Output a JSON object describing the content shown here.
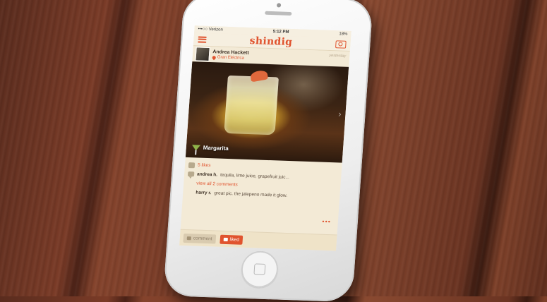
{
  "status_bar": {
    "carrier": "•••○○ Verizon",
    "time": "5:12 PM",
    "battery": "18%"
  },
  "nav": {
    "logo": "shindig"
  },
  "post": {
    "author": "Andrea Hackett",
    "location": "Gran Eléctrica",
    "time": "yesterday",
    "drink_name": "Margarita",
    "likes": "5 likes",
    "comments": [
      {
        "name": "andrea h.",
        "text": "tequila, lime juice, grapefruit juic..."
      },
      {
        "name": "harry r.",
        "text": "great pic. the jalepeno made it glow."
      }
    ],
    "view_all": "view all 2 comments",
    "more": "•••"
  },
  "actions": {
    "comment_label": "comment",
    "liked_label": "liked"
  },
  "colors": {
    "accent": "#e0532e",
    "paper": "#f3ead6"
  }
}
